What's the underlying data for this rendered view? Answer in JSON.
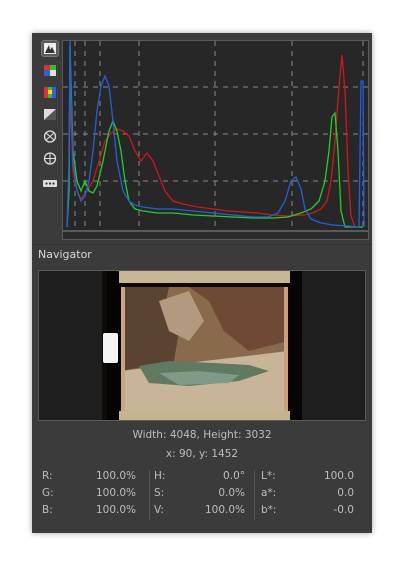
{
  "toolbar": {
    "icons": [
      "histogram-linear-icon",
      "rgb-channels-icon",
      "bar-display-icon",
      "chroma-icon",
      "raw-icon",
      "crosshair-icon",
      "more-icon"
    ]
  },
  "histogram": {
    "colors": {
      "red": "#d01818",
      "green": "#22d022",
      "blue": "#2060e0",
      "grid": "#8a8a8a"
    }
  },
  "navigator": {
    "title": "Navigator",
    "dimensions": "Width: 4048, Height: 3032",
    "coords": "x: 90, y: 1452"
  },
  "values": {
    "rgb": [
      {
        "label": "R:",
        "value": "100.0%"
      },
      {
        "label": "G:",
        "value": "100.0%"
      },
      {
        "label": "B:",
        "value": "100.0%"
      }
    ],
    "hsv": [
      {
        "label": "H:",
        "value": "0.0°"
      },
      {
        "label": "S:",
        "value": "0.0%"
      },
      {
        "label": "V:",
        "value": "100.0%"
      }
    ],
    "lab": [
      {
        "label": "L*:",
        "value": "100.0"
      },
      {
        "label": "a*:",
        "value": "0.0"
      },
      {
        "label": "b*:",
        "value": "-0.0"
      }
    ]
  }
}
